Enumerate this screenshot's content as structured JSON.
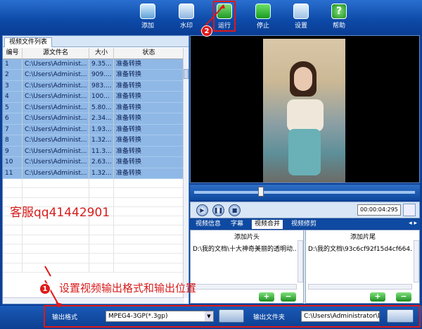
{
  "toolbar": {
    "add": "添加",
    "watermark": "水印",
    "run": "运行",
    "stop": "停止",
    "settings": "设置",
    "help": "帮助"
  },
  "file_list": {
    "tab": "视频文件列表",
    "columns": [
      "编号",
      "源文件名",
      "大小",
      "状态"
    ],
    "rows": [
      [
        "1",
        "C:\\Users\\Administ...",
        "9.35...",
        "准备转换"
      ],
      [
        "2",
        "C:\\Users\\Administ...",
        "909....",
        "准备转换"
      ],
      [
        "3",
        "C:\\Users\\Administ...",
        "983....",
        "准备转换"
      ],
      [
        "4",
        "C:\\Users\\Administ...",
        "100...",
        "准备转换"
      ],
      [
        "5",
        "C:\\Users\\Administ...",
        "5.80...",
        "准备转换"
      ],
      [
        "6",
        "C:\\Users\\Administ...",
        "2.34...",
        "准备转换"
      ],
      [
        "7",
        "C:\\Users\\Administ...",
        "1.93...",
        "准备转换"
      ],
      [
        "8",
        "C:\\Users\\Administ...",
        "1.32...",
        "准备转换"
      ],
      [
        "9",
        "C:\\Users\\Administ...",
        "11.3...",
        "准备转换"
      ],
      [
        "10",
        "C:\\Users\\Administ...",
        "2.63...",
        "准备转换"
      ],
      [
        "11",
        "C:\\Users\\Administ...",
        "1.32...",
        "准备转换"
      ]
    ]
  },
  "contact": "客服qq41442901",
  "player": {
    "time": "00:00:04:295",
    "progress_fraction": 0.29
  },
  "sub_tabs": [
    "视频信息",
    "字幕",
    "视频合并",
    "视频修剪"
  ],
  "sub_tab_arrows": "◂ ▸",
  "merge": {
    "head_label": "添加片头",
    "tail_label": "添加片尾",
    "head_file": "D:\\我的文档\\十大神奇美丽的透明动...",
    "tail_file": "D:\\我的文档\\93c6cf92f15d4cf664..."
  },
  "output": {
    "format_label": "输出格式",
    "format_value": "MPEG4-3GP(*.3gp)",
    "folder_label": "输出文件夹",
    "folder_value": "C:\\Users\\Administrator\\Des"
  },
  "annotations": {
    "badge1": "1",
    "badge2": "2",
    "note": "设置视频输出格式和输出位置",
    "color": "#e01818"
  }
}
